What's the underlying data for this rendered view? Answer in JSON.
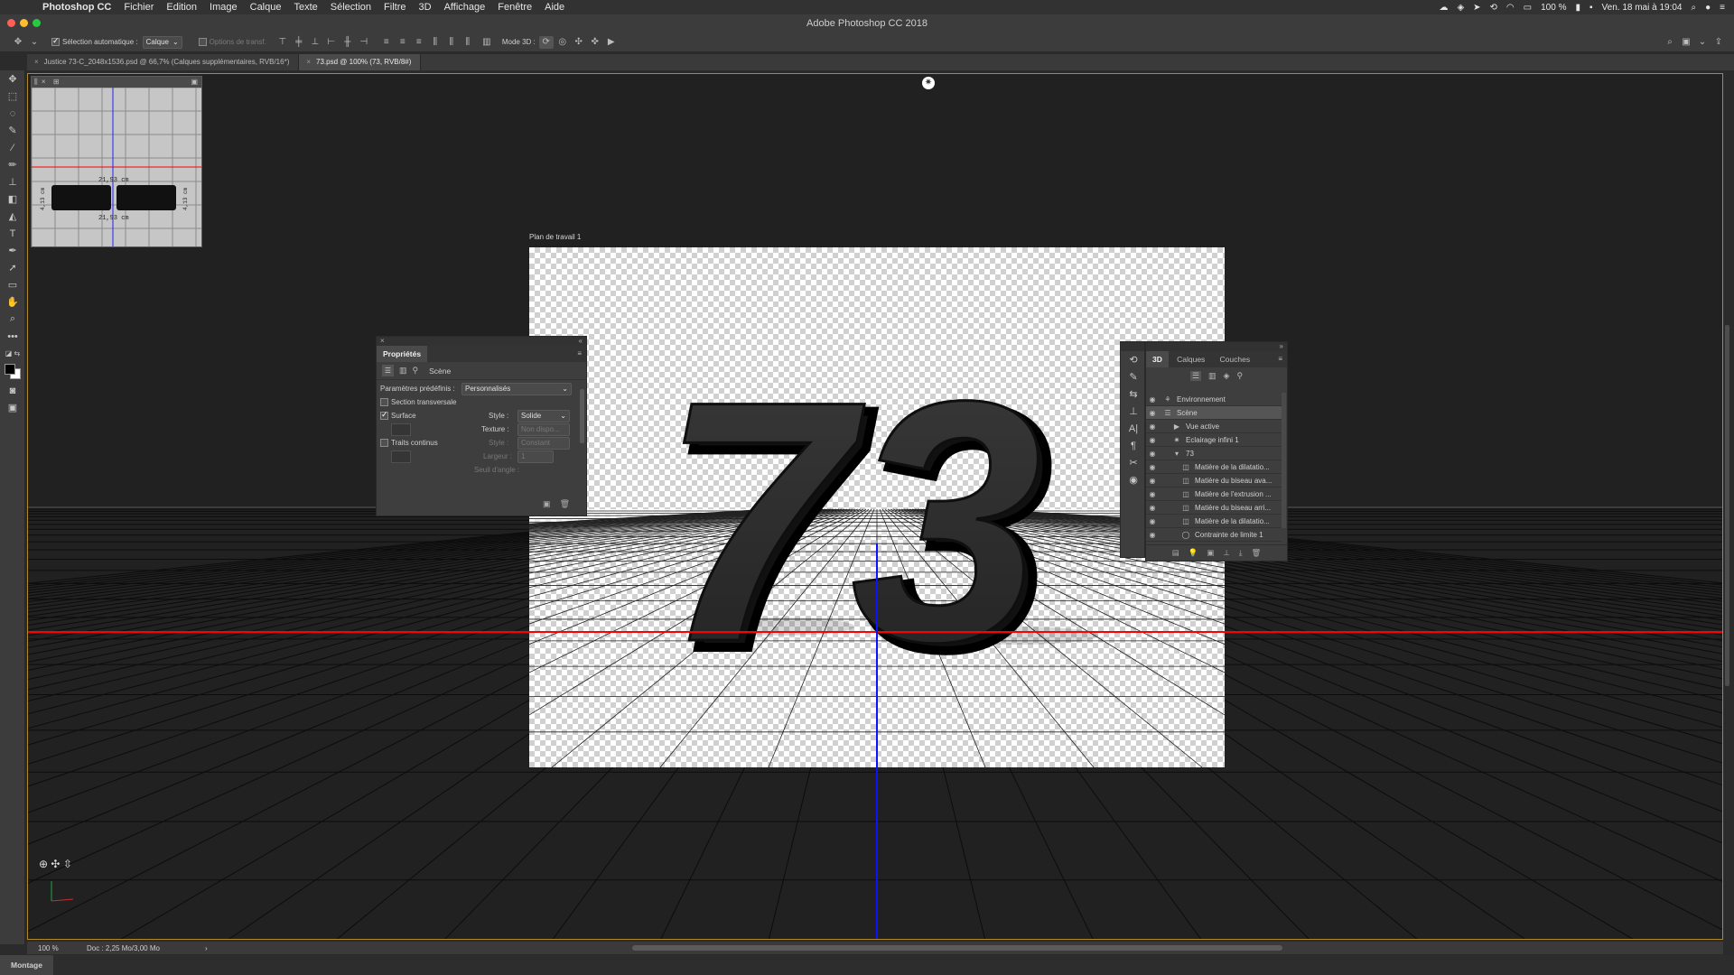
{
  "menubar": {
    "app": "Photoshop CC",
    "items": [
      "Fichier",
      "Edition",
      "Image",
      "Calque",
      "Texte",
      "Sélection",
      "Filtre",
      "3D",
      "Affichage",
      "Fenêtre",
      "Aide"
    ],
    "battery": "100 %",
    "datetime": "Ven. 18 mai à 19:04"
  },
  "window": {
    "title": "Adobe Photoshop CC 2018"
  },
  "options_bar": {
    "auto_select_label": "Sélection automatique :",
    "auto_select_checked": true,
    "auto_select_target": "Calque",
    "transform_options": "Options de transf.",
    "mode3d_label": "Mode 3D :"
  },
  "tabs": [
    {
      "label": "Justice 73-C_2048x1536.psd @ 66,7% (Calques supplémentaires, RVB/16*)",
      "active": false
    },
    {
      "label": "73.psd @ 100% (73, RVB/8#)",
      "active": true
    }
  ],
  "navigator": {
    "measure_top": "21,93 cm",
    "measure_bottom": "21,93 cm",
    "measure_left": "4,13 cm",
    "measure_right": "4,13 cm"
  },
  "artboard": {
    "label": "Plan de travail 1",
    "content_text": "73"
  },
  "properties_panel": {
    "title": "Propriétés",
    "section": "Scène",
    "preset_label": "Paramètres prédéfinis :",
    "preset_value": "Personnalisés",
    "cross_section_label": "Section transversale",
    "cross_section_checked": false,
    "surface_label": "Surface",
    "surface_checked": true,
    "style_label": "Style :",
    "style_value": "Solide",
    "texture_label": "Texture :",
    "texture_value": "Non dispo...",
    "lines_label": "Traits continus",
    "lines_checked": false,
    "lines_style_label": "Style :",
    "lines_style_value": "Constant",
    "width_label": "Largeur :",
    "width_value": "1",
    "angle_label": "Seuil d'angle :"
  },
  "layers_panel": {
    "tabs": [
      "3D",
      "Calques",
      "Couches"
    ],
    "active_tab": "3D",
    "rows": [
      {
        "label": "Environnement",
        "indent": 0,
        "selected": false,
        "icon": "environment-icon"
      },
      {
        "label": "Scène",
        "indent": 0,
        "selected": true,
        "icon": "scene-icon"
      },
      {
        "label": "Vue active",
        "indent": 1,
        "selected": false,
        "icon": "camera-icon"
      },
      {
        "label": "Eclairage infini 1",
        "indent": 1,
        "selected": false,
        "icon": "light-icon"
      },
      {
        "label": "73",
        "indent": 1,
        "selected": false,
        "icon": "mesh-icon"
      },
      {
        "label": "Matière de la dilatatio...",
        "indent": 2,
        "selected": false,
        "icon": "material-icon"
      },
      {
        "label": "Matière du biseau ava...",
        "indent": 2,
        "selected": false,
        "icon": "material-icon"
      },
      {
        "label": "Matière de l'extrusion ...",
        "indent": 2,
        "selected": false,
        "icon": "material-icon"
      },
      {
        "label": "Matière du biseau arri...",
        "indent": 2,
        "selected": false,
        "icon": "material-icon"
      },
      {
        "label": "Matière de la dilatatio...",
        "indent": 2,
        "selected": false,
        "icon": "material-icon"
      },
      {
        "label": "Contrainte de limite 1",
        "indent": 2,
        "selected": false,
        "icon": "constraint-icon"
      }
    ]
  },
  "status": {
    "zoom": "100 %",
    "doc": "Doc : 2,25 Mo/3,00 Mo"
  },
  "workspace": {
    "label": "Montage"
  },
  "colors": {
    "guide_horizontal": "#ff0000",
    "guide_vertical": "#0000ff",
    "canvas_border": "#b08a2a"
  }
}
